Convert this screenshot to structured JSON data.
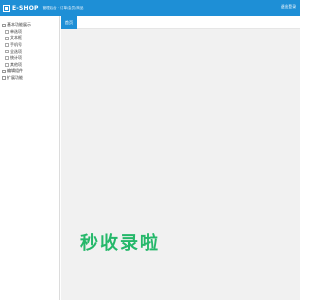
{
  "header": {
    "logo_text": "E-SHOP",
    "subtitle": "管理后台 · 订单/会员/商品",
    "user_link": "退出登录"
  },
  "sidebar": {
    "items": [
      {
        "label": "基本功能展示",
        "level": 0
      },
      {
        "label": "单选项",
        "level": 1
      },
      {
        "label": "文本框",
        "level": 1
      },
      {
        "label": "手机号",
        "level": 1
      },
      {
        "label": "全选项",
        "level": 1
      },
      {
        "label": "统计项",
        "level": 1
      },
      {
        "label": "其他项",
        "level": 1
      },
      {
        "label": "编辑组件",
        "level": 0
      },
      {
        "label": "扩展功能",
        "level": 0
      }
    ]
  },
  "tabs": {
    "active": "首页"
  },
  "watermark": {
    "text": "秒收录啦",
    "color": "#25b86a"
  },
  "colors": {
    "accent": "#1e8fd6",
    "content_bg": "#f1f1f1"
  }
}
